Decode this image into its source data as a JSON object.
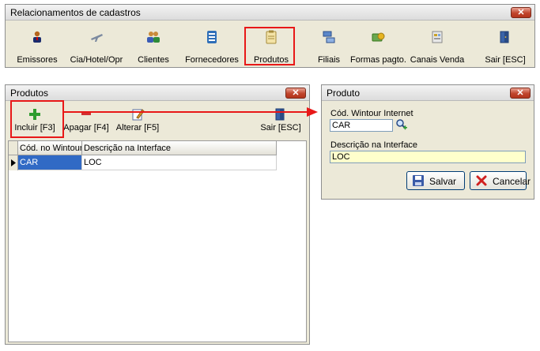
{
  "main_window": {
    "title": "Relacionamentos de cadastros",
    "close": "✕",
    "toolbar": [
      {
        "label": "Emissores",
        "icon": "users-icon"
      },
      {
        "label": "Cia/Hotel/Opr",
        "icon": "airplane-icon"
      },
      {
        "label": "Clientes",
        "icon": "clients-icon"
      },
      {
        "label": "Fornecedores",
        "icon": "supplier-icon"
      },
      {
        "label": "Produtos",
        "icon": "product-icon"
      },
      {
        "label": "Filiais",
        "icon": "branches-icon"
      },
      {
        "label": "Formas pagto.",
        "icon": "payment-icon"
      },
      {
        "label": "Canais Venda",
        "icon": "sales-channel-icon"
      },
      {
        "label": "Sair [ESC]",
        "icon": "exit-door-icon"
      }
    ]
  },
  "produtos_window": {
    "title": "Produtos",
    "close": "✕",
    "toolbar": {
      "incluir": "Incluir [F3]",
      "apagar": "Apagar [F4]",
      "alterar": "Alterar [F5]",
      "sair": "Sair [ESC]"
    },
    "grid": {
      "columns": [
        "Cód. no Wintour",
        "Descrição na Interface"
      ],
      "rows": [
        {
          "codigo": "CAR",
          "descricao": "LOC"
        }
      ]
    }
  },
  "produto_dialog": {
    "title": "Produto",
    "close": "✕",
    "codigo_label": "Cód. Wintour Internet",
    "codigo_value": "CAR",
    "descricao_label": "Descrição na Interface",
    "descricao_value": "LOC",
    "salvar": "Salvar",
    "cancelar": "Cancelar"
  },
  "colors": {
    "highlight": "#e81818",
    "selection": "#316ac5"
  }
}
